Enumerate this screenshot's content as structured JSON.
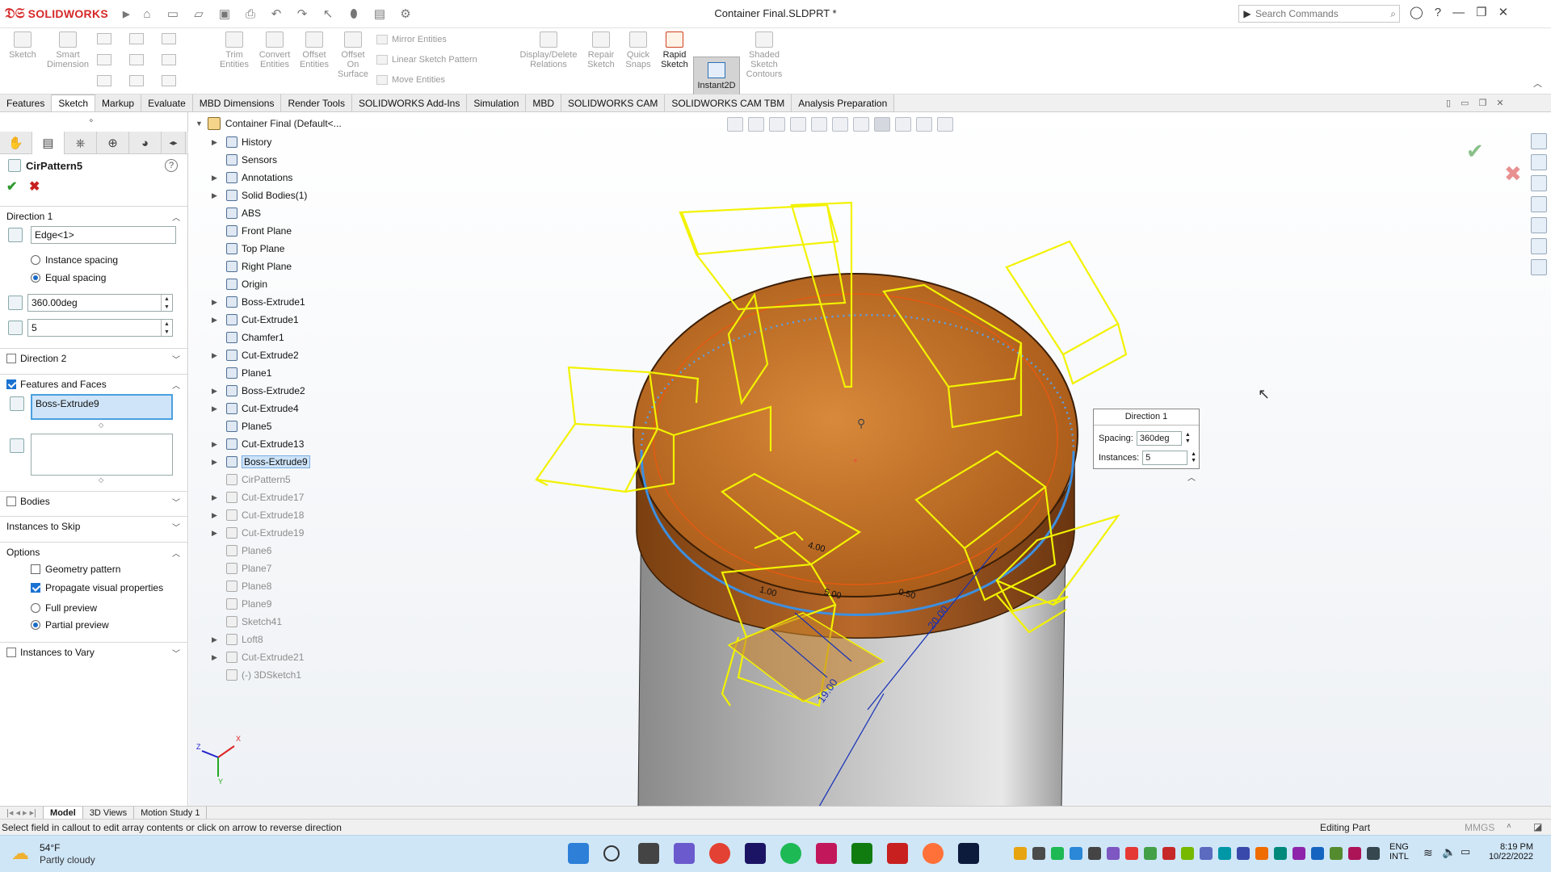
{
  "app": {
    "logo_text": "SOLIDWORKS",
    "document_title": "Container Final.SLDPRT *",
    "search_placeholder": "Search Commands"
  },
  "ribbon": {
    "sketch": "Sketch",
    "smart_dimension": "Smart\nDimension",
    "trim": "Trim\nEntities",
    "convert": "Convert\nEntities",
    "offset": "Offset\nEntities",
    "offset_surface": "Offset\nOn\nSurface",
    "mirror": "Mirror Entities",
    "linear_pattern": "Linear Sketch Pattern",
    "move": "Move Entities",
    "display_delete": "Display/Delete\nRelations",
    "repair": "Repair\nSketch",
    "quick_snaps": "Quick\nSnaps",
    "rapid_sketch": "Rapid\nSketch",
    "instant2d": "Instant2D",
    "shaded": "Shaded\nSketch\nContours"
  },
  "tabs": [
    "Features",
    "Sketch",
    "Markup",
    "Evaluate",
    "MBD Dimensions",
    "Render Tools",
    "SOLIDWORKS Add-Ins",
    "Simulation",
    "MBD",
    "SOLIDWORKS CAM",
    "SOLIDWORKS CAM TBM",
    "Analysis Preparation"
  ],
  "active_tab": "Sketch",
  "property_manager": {
    "title": "CirPattern5",
    "direction1_label": "Direction 1",
    "edge_value": "Edge<1>",
    "instance_spacing": "Instance spacing",
    "equal_spacing": "Equal spacing",
    "angle_value": "360.00deg",
    "count_value": "5",
    "direction2_label": "Direction 2",
    "features_faces_label": "Features and Faces",
    "feature_selected": "Boss-Extrude9",
    "bodies_label": "Bodies",
    "instances_skip_label": "Instances to Skip",
    "options_label": "Options",
    "geometry_pattern": "Geometry pattern",
    "propagate_visual": "Propagate visual properties",
    "full_preview": "Full preview",
    "partial_preview": "Partial preview",
    "instances_vary_label": "Instances to Vary"
  },
  "tree": {
    "root": "Container Final  (Default<...",
    "items": [
      {
        "label": "History",
        "arrow": "▶",
        "dim": false
      },
      {
        "label": "Sensors",
        "arrow": "",
        "dim": false
      },
      {
        "label": "Annotations",
        "arrow": "▶",
        "dim": false
      },
      {
        "label": "Solid Bodies(1)",
        "arrow": "▶",
        "dim": false
      },
      {
        "label": "ABS",
        "arrow": "",
        "dim": false
      },
      {
        "label": "Front Plane",
        "arrow": "",
        "dim": false
      },
      {
        "label": "Top Plane",
        "arrow": "",
        "dim": false
      },
      {
        "label": "Right Plane",
        "arrow": "",
        "dim": false
      },
      {
        "label": "Origin",
        "arrow": "",
        "dim": false
      },
      {
        "label": "Boss-Extrude1",
        "arrow": "▶",
        "dim": false
      },
      {
        "label": "Cut-Extrude1",
        "arrow": "▶",
        "dim": false
      },
      {
        "label": "Chamfer1",
        "arrow": "",
        "dim": false
      },
      {
        "label": "Cut-Extrude2",
        "arrow": "▶",
        "dim": false
      },
      {
        "label": "Plane1",
        "arrow": "",
        "dim": false
      },
      {
        "label": "Boss-Extrude2",
        "arrow": "▶",
        "dim": false
      },
      {
        "label": "Cut-Extrude4",
        "arrow": "▶",
        "dim": false
      },
      {
        "label": "Plane5",
        "arrow": "",
        "dim": false
      },
      {
        "label": "Cut-Extrude13",
        "arrow": "▶",
        "dim": false
      },
      {
        "label": "Boss-Extrude9",
        "arrow": "▶",
        "dim": false,
        "selected": true
      },
      {
        "label": "CirPattern5",
        "arrow": "",
        "dim": true
      },
      {
        "label": "Cut-Extrude17",
        "arrow": "▶",
        "dim": true
      },
      {
        "label": "Cut-Extrude18",
        "arrow": "▶",
        "dim": true
      },
      {
        "label": "Cut-Extrude19",
        "arrow": "▶",
        "dim": true
      },
      {
        "label": "Plane6",
        "arrow": "",
        "dim": true
      },
      {
        "label": "Plane7",
        "arrow": "",
        "dim": true
      },
      {
        "label": "Plane8",
        "arrow": "",
        "dim": true
      },
      {
        "label": "Plane9",
        "arrow": "",
        "dim": true
      },
      {
        "label": "Sketch41",
        "arrow": "",
        "dim": true
      },
      {
        "label": "Loft8",
        "arrow": "▶",
        "dim": true
      },
      {
        "label": "Cut-Extrude21",
        "arrow": "▶",
        "dim": true
      },
      {
        "label": "(-) 3DSketch1",
        "arrow": "",
        "dim": true
      }
    ]
  },
  "callout": {
    "title": "Direction 1",
    "spacing_label": "Spacing:",
    "spacing_value": "360deg",
    "instances_label": "Instances:",
    "instances_value": "5"
  },
  "dimensions": [
    "20.00",
    "19.00",
    "1.00",
    "5.00",
    "0.50",
    "4.00"
  ],
  "axes": {
    "x": "X",
    "y": "Y",
    "z": "Z"
  },
  "bottom_tabs": [
    "Model",
    "3D Views",
    "Motion Study 1"
  ],
  "status": {
    "message": "Select field in callout to edit array contents or click on arrow to reverse direction",
    "mode": "Editing Part",
    "units": "MMGS"
  },
  "taskbar": {
    "weather_temp": "54°F",
    "weather_desc": "Partly cloudy",
    "lang1": "ENG",
    "lang2": "INTL",
    "time": "8:19 PM",
    "date": "10/22/2022"
  },
  "colors": {
    "orange_part": "#c8711e",
    "yellow_preview": "#f2f200",
    "accent_blue": "#1a73d2"
  }
}
